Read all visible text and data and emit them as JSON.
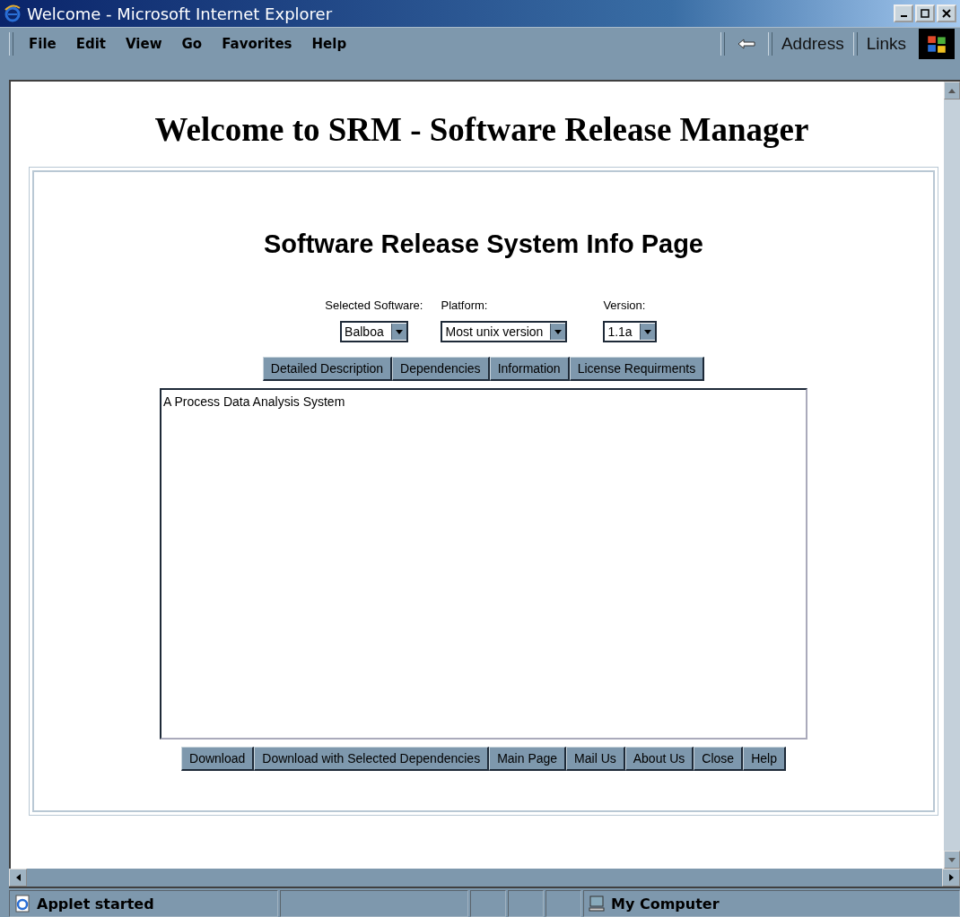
{
  "window": {
    "title": "Welcome - Microsoft Internet Explorer"
  },
  "menu": [
    "File",
    "Edit",
    "View",
    "Go",
    "Favorites",
    "Help"
  ],
  "toolbar": {
    "address_label": "Address",
    "links_label": "Links"
  },
  "page": {
    "heading": "Welcome to SRM - Software Release Manager",
    "subheading": "Software Release System Info Page",
    "selects": [
      {
        "label": "Selected Software:",
        "value": "Balboa"
      },
      {
        "label": "Platform:",
        "value": "Most unix version"
      },
      {
        "label": "Version:",
        "value": "1.1a"
      }
    ],
    "tabs": [
      "Detailed Description",
      "Dependencies",
      "Information",
      "License Requirments"
    ],
    "description": "A Process Data Analysis System",
    "buttons": [
      "Download",
      "Download with Selected Dependencies",
      "Main Page",
      "Mail Us",
      "About Us",
      "Close",
      "Help"
    ]
  },
  "status_bar": {
    "message": "Applet started",
    "zone": "My Computer"
  }
}
